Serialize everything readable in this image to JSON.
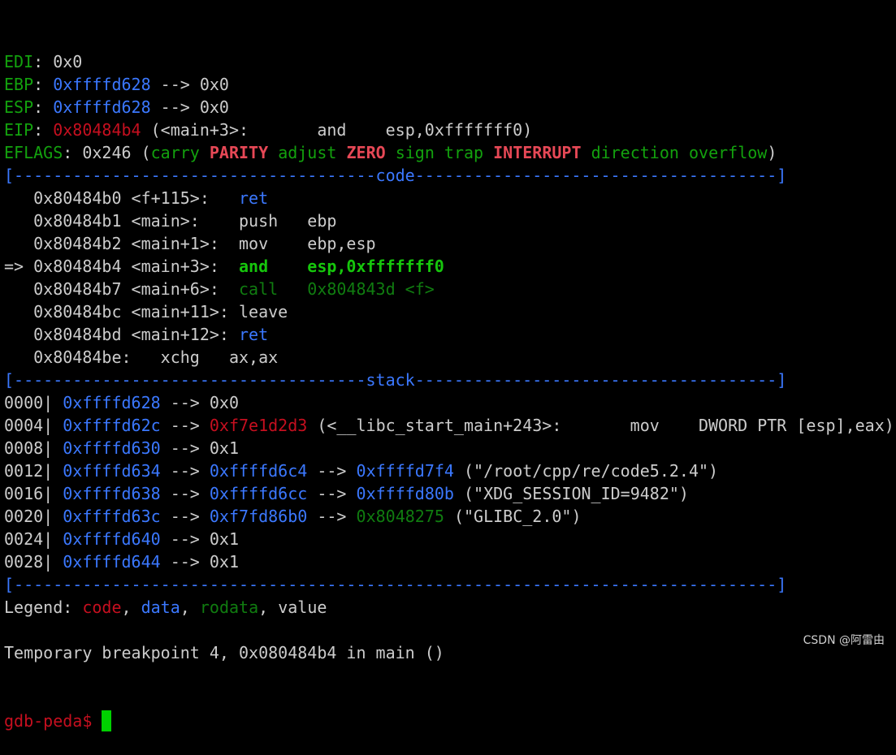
{
  "terminal": {
    "lines": [
      [
        {
          "t": "EDI",
          "c": "green"
        },
        {
          "t": ": 0x0",
          "c": "white"
        }
      ],
      [
        {
          "t": "EBP",
          "c": "green"
        },
        {
          "t": ": ",
          "c": "white"
        },
        {
          "t": "0xffffd628",
          "c": "blue"
        },
        {
          "t": " --> 0x0",
          "c": "white"
        }
      ],
      [
        {
          "t": "ESP",
          "c": "green"
        },
        {
          "t": ": ",
          "c": "white"
        },
        {
          "t": "0xffffd628",
          "c": "blue"
        },
        {
          "t": " --> 0x0",
          "c": "white"
        }
      ],
      [
        {
          "t": "EIP",
          "c": "green"
        },
        {
          "t": ": ",
          "c": "white"
        },
        {
          "t": "0x80484b4",
          "c": "red"
        },
        {
          "t": " (<main+3>:       and    esp,0xfffffff0)",
          "c": "white"
        }
      ],
      [
        {
          "t": "EFLAGS",
          "c": "green"
        },
        {
          "t": ": 0x246 (",
          "c": "white"
        },
        {
          "t": "carry",
          "c": "green"
        },
        {
          "t": " ",
          "c": "white"
        },
        {
          "t": "PARITY",
          "c": "bred"
        },
        {
          "t": " ",
          "c": "white"
        },
        {
          "t": "adjust",
          "c": "green"
        },
        {
          "t": " ",
          "c": "white"
        },
        {
          "t": "ZERO",
          "c": "bred"
        },
        {
          "t": " ",
          "c": "white"
        },
        {
          "t": "sign",
          "c": "green"
        },
        {
          "t": " ",
          "c": "white"
        },
        {
          "t": "trap",
          "c": "green"
        },
        {
          "t": " ",
          "c": "white"
        },
        {
          "t": "INTERRUPT",
          "c": "bred"
        },
        {
          "t": " ",
          "c": "white"
        },
        {
          "t": "direction",
          "c": "green"
        },
        {
          "t": " ",
          "c": "white"
        },
        {
          "t": "overflow",
          "c": "green"
        },
        {
          "t": ")",
          "c": "white"
        }
      ],
      [
        {
          "t": "[-------------------------------------code-------------------------------------]",
          "c": "blue"
        }
      ],
      [
        {
          "t": "   0x80484b0 <f+115>:   ",
          "c": "white"
        },
        {
          "t": "ret",
          "c": "blue"
        }
      ],
      [
        {
          "t": "   0x80484b1 <main>:    push   ebp",
          "c": "white"
        }
      ],
      [
        {
          "t": "   0x80484b2 <main+1>:  mov    ebp,esp",
          "c": "white"
        }
      ],
      [
        {
          "t": "=> 0x80484b4 <main+3>:  ",
          "c": "white"
        },
        {
          "t": "and    esp,0xfffffff0",
          "c": "bgreen"
        }
      ],
      [
        {
          "t": "   0x80484b7 <main+6>:  ",
          "c": "white"
        },
        {
          "t": "call   0x804843d <f>",
          "c": "dgreen"
        }
      ],
      [
        {
          "t": "   0x80484bc <main+11>: leave",
          "c": "white"
        }
      ],
      [
        {
          "t": "   0x80484bd <main+12>: ",
          "c": "white"
        },
        {
          "t": "ret",
          "c": "blue"
        }
      ],
      [
        {
          "t": "   0x80484be:   xchg   ax,ax",
          "c": "white"
        }
      ],
      [
        {
          "t": "[------------------------------------stack-------------------------------------]",
          "c": "blue"
        }
      ],
      [
        {
          "t": "0000| ",
          "c": "white"
        },
        {
          "t": "0xffffd628",
          "c": "blue"
        },
        {
          "t": " --> 0x0",
          "c": "white"
        }
      ],
      [
        {
          "t": "0004| ",
          "c": "white"
        },
        {
          "t": "0xffffd62c",
          "c": "blue"
        },
        {
          "t": " --> ",
          "c": "white"
        },
        {
          "t": "0xf7e1d2d3",
          "c": "red"
        },
        {
          "t": " (<__libc_start_main+243>:       mov    DWORD PTR [esp],eax)",
          "c": "white"
        }
      ],
      [
        {
          "t": "0008| ",
          "c": "white"
        },
        {
          "t": "0xffffd630",
          "c": "blue"
        },
        {
          "t": " --> 0x1",
          "c": "white"
        }
      ],
      [
        {
          "t": "0012| ",
          "c": "white"
        },
        {
          "t": "0xffffd634",
          "c": "blue"
        },
        {
          "t": " --> ",
          "c": "white"
        },
        {
          "t": "0xffffd6c4",
          "c": "blue"
        },
        {
          "t": " --> ",
          "c": "white"
        },
        {
          "t": "0xffffd7f4",
          "c": "blue"
        },
        {
          "t": " (\"/root/cpp/re/code5.2.4\")",
          "c": "white"
        }
      ],
      [
        {
          "t": "0016| ",
          "c": "white"
        },
        {
          "t": "0xffffd638",
          "c": "blue"
        },
        {
          "t": " --> ",
          "c": "white"
        },
        {
          "t": "0xffffd6cc",
          "c": "blue"
        },
        {
          "t": " --> ",
          "c": "white"
        },
        {
          "t": "0xffffd80b",
          "c": "blue"
        },
        {
          "t": " (\"XDG_SESSION_ID=9482\")",
          "c": "white"
        }
      ],
      [
        {
          "t": "0020| ",
          "c": "white"
        },
        {
          "t": "0xffffd63c",
          "c": "blue"
        },
        {
          "t": " --> ",
          "c": "white"
        },
        {
          "t": "0xf7fd86b0",
          "c": "blue"
        },
        {
          "t": " --> ",
          "c": "white"
        },
        {
          "t": "0x8048275",
          "c": "dgreen"
        },
        {
          "t": " (\"GLIBC_2.0\")",
          "c": "white"
        }
      ],
      [
        {
          "t": "0024| ",
          "c": "white"
        },
        {
          "t": "0xffffd640",
          "c": "blue"
        },
        {
          "t": " --> 0x1",
          "c": "white"
        }
      ],
      [
        {
          "t": "0028| ",
          "c": "white"
        },
        {
          "t": "0xffffd644",
          "c": "blue"
        },
        {
          "t": " --> 0x1",
          "c": "white"
        }
      ],
      [
        {
          "t": "[------------------------------------------------------------------------------]",
          "c": "blue"
        }
      ],
      [
        {
          "t": "Legend: ",
          "c": "white"
        },
        {
          "t": "code",
          "c": "red"
        },
        {
          "t": ", ",
          "c": "white"
        },
        {
          "t": "data",
          "c": "blue"
        },
        {
          "t": ", ",
          "c": "white"
        },
        {
          "t": "rodata",
          "c": "dgreen"
        },
        {
          "t": ", value",
          "c": "white"
        }
      ],
      [],
      [
        {
          "t": "Temporary breakpoint 4, 0x080484b4 in main ()",
          "c": "white"
        }
      ]
    ],
    "prompt": "gdb-peda$ "
  },
  "colors": {
    "white": "#cccccc",
    "green": "#13a10e",
    "blue": "#3b78ff",
    "red": "#c50f1f",
    "bred": "#e74856",
    "bgreen": "#16c60c",
    "dgreen": "#107c10",
    "cursor": "#00d000"
  },
  "watermark": "CSDN @阿雷由"
}
